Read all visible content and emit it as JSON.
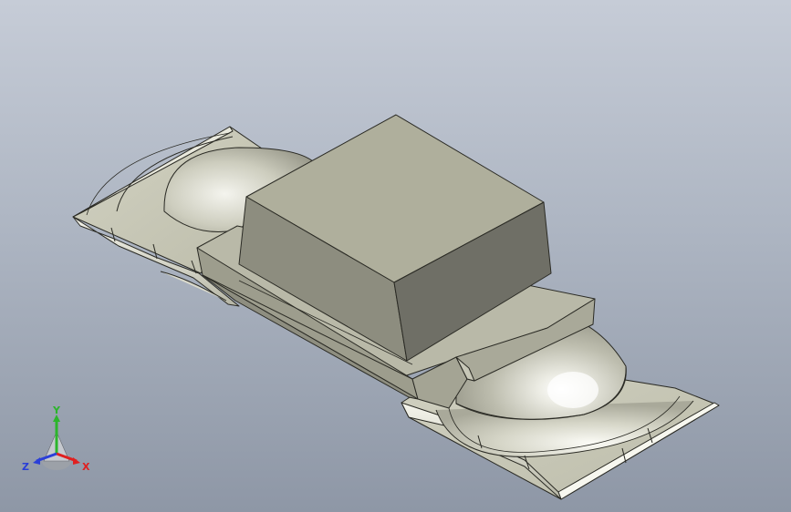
{
  "viewport": {
    "background_top": "#c6ccd7",
    "background_bottom": "#8e97a6",
    "model_color": "#c9c9b7",
    "edge_color": "#2a2a24"
  },
  "triad": {
    "x_label": "X",
    "y_label": "Y",
    "z_label": "Z",
    "x_color": "#e02020",
    "y_color": "#2cb52c",
    "z_color": "#2a3fd8"
  }
}
